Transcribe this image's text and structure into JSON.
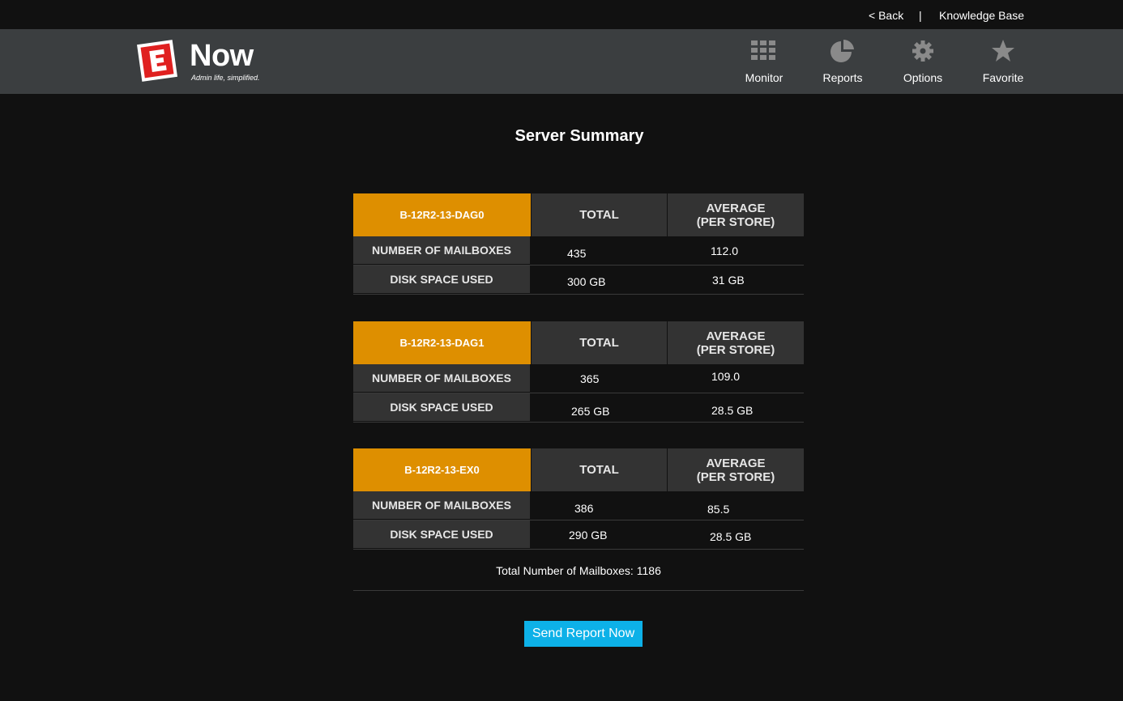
{
  "topbar": {
    "back_label": "< Back",
    "separator": "|",
    "knowledge_base_label": "Knowledge Base"
  },
  "header": {
    "brand": "Now",
    "tagline": "Admin life, simplified.",
    "logo_letter": "E",
    "nav": [
      {
        "label": "Monitor",
        "icon": "grid-icon"
      },
      {
        "label": "Reports",
        "icon": "pie-chart-icon"
      },
      {
        "label": "Options",
        "icon": "gear-icon"
      },
      {
        "label": "Favorite",
        "icon": "star-icon"
      }
    ]
  },
  "colors": {
    "accent_orange": "#de8f00",
    "button_blue": "#0db1e8",
    "logo_red": "#e02020"
  },
  "page": {
    "title": "Server Summary",
    "column_total": "TOTAL",
    "column_average_line1": "AVERAGE",
    "column_average_line2": "(PER STORE)",
    "row_mailboxes": "NUMBER OF MAILBOXES",
    "row_disk": "DISK SPACE USED",
    "servers": [
      {
        "name": "B-12R2-13-DAG0",
        "mailboxes_total": "435",
        "mailboxes_avg": "112.0",
        "disk_total": "300 GB",
        "disk_avg": "31 GB"
      },
      {
        "name": "B-12R2-13-DAG1",
        "mailboxes_total": "365",
        "mailboxes_avg": "109.0",
        "disk_total": "265 GB",
        "disk_avg": "28.5 GB"
      },
      {
        "name": "B-12R2-13-EX0",
        "mailboxes_total": "386",
        "mailboxes_avg": "85.5",
        "disk_total": "290 GB",
        "disk_avg": "28.5 GB"
      }
    ],
    "total_label": "Total Number of Mailboxes:",
    "total_value": "1186",
    "send_button": "Send Report Now"
  }
}
